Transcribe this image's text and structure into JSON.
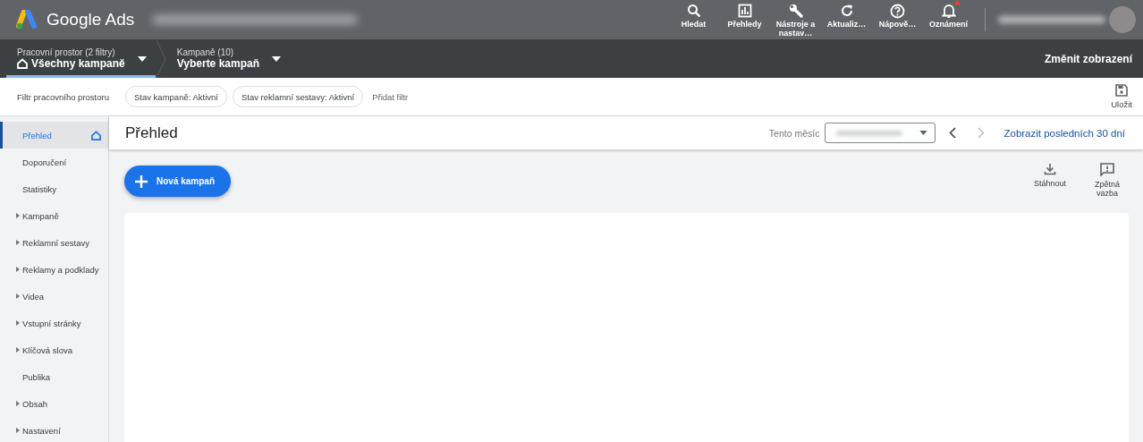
{
  "top_bar": {
    "logo_text": "Google Ads",
    "actions": [
      {
        "kind": "search",
        "label": "Hledat",
        "alert": false
      },
      {
        "kind": "reports",
        "label": "Přehledy",
        "alert": false
      },
      {
        "kind": "tools",
        "label": "Nástroje a nastav…",
        "alert": false
      },
      {
        "kind": "refresh",
        "label": "Aktualiz…",
        "alert": false
      },
      {
        "kind": "help",
        "label": "Nápově…",
        "alert": false
      },
      {
        "kind": "bell",
        "label": "Oznámení",
        "alert": true
      }
    ]
  },
  "nav_bar": {
    "pickers": [
      {
        "caption": "Pracovní prostor (2 filtry)",
        "value": "Všechny kampaně",
        "home": true,
        "selected": true
      },
      {
        "caption": "Kampaně (10)",
        "value": "Vyberte kampaň",
        "home": false,
        "selected": false
      }
    ],
    "view_link": "Změnit zobrazení"
  },
  "filter_bar": {
    "label": "Filtr pracovního prostoru",
    "chips": [
      "Stav kampaně: Aktivní",
      "Stav reklamní sestavy: Aktivní"
    ],
    "add_filter": "Přidat filtr",
    "save": "Uložit"
  },
  "sidebar": {
    "items": [
      {
        "label": "Přehled",
        "expandable": false,
        "home": true,
        "selected": true
      },
      {
        "label": "Doporučení",
        "expandable": false,
        "home": false,
        "selected": false
      },
      {
        "label": "Statistiky",
        "expandable": false,
        "home": false,
        "selected": false
      },
      {
        "label": "Kampaně",
        "expandable": true,
        "home": false,
        "selected": false
      },
      {
        "label": "Reklamní sestavy",
        "expandable": true,
        "home": false,
        "selected": false
      },
      {
        "label": "Reklamy a podklady",
        "expandable": true,
        "home": false,
        "selected": false
      },
      {
        "label": "Videa",
        "expandable": true,
        "home": false,
        "selected": false
      },
      {
        "label": "Vstupní stránky",
        "expandable": true,
        "home": false,
        "selected": false
      },
      {
        "label": "Klíčová slova",
        "expandable": true,
        "home": false,
        "selected": false
      },
      {
        "label": "Publika",
        "expandable": false,
        "home": false,
        "selected": false
      },
      {
        "label": "Obsah",
        "expandable": true,
        "home": false,
        "selected": false
      },
      {
        "label": "Nastavení",
        "expandable": true,
        "home": false,
        "selected": false
      }
    ]
  },
  "page": {
    "title": "Přehled",
    "range_label": "Tento měsíc",
    "last30_link": "Zobrazit posledních 30 dní",
    "new_campaign": "Nová kampaň",
    "tools": [
      {
        "kind": "download",
        "label": "Stáhnout"
      },
      {
        "kind": "feedback",
        "label": "Zpětná vazba"
      }
    ]
  }
}
